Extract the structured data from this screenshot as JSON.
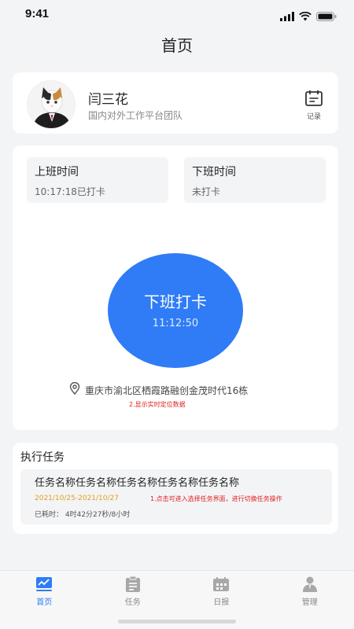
{
  "status_bar": {
    "time": "9:41",
    "icons": [
      "signal-icon",
      "wifi-icon",
      "battery-icon"
    ]
  },
  "nav": {
    "title": "首页"
  },
  "profile": {
    "name": "闫三花",
    "team": "国内对外工作平台团队",
    "record_label": "记录",
    "record_icon": "calendar-record-icon"
  },
  "attendance": {
    "clock_in": {
      "title": "上班时间",
      "value": "10:17:18已打卡"
    },
    "clock_out": {
      "title": "下班时间",
      "value": "未打卡"
    },
    "button": {
      "label": "下班打卡",
      "time": "11:12:50"
    },
    "location": {
      "text": "重庆市渝北区栖霞路融创金茂时代16栋",
      "note": "2.显示实时定位数据",
      "icon": "location-pin-icon"
    }
  },
  "tasks": {
    "section_title": "执行任务",
    "items": [
      {
        "name": "任务名称任务名称任务名称任务名称任务名称",
        "date_range": "2021/10/25-2021/10/27",
        "note": "1.点击可进入选择任务界面，进行切换任务操作",
        "elapsed": "已耗时：  4时42分27秒/8小时"
      }
    ]
  },
  "tab_bar": {
    "tabs": [
      {
        "label": "首页",
        "icon": "home-chart-icon",
        "active": true
      },
      {
        "label": "任务",
        "icon": "clipboard-icon",
        "active": false
      },
      {
        "label": "日报",
        "icon": "calendar-icon",
        "active": false
      },
      {
        "label": "管理",
        "icon": "manager-icon",
        "active": false
      }
    ]
  },
  "colors": {
    "accent": "#2f7cf6",
    "note_red": "#e02020",
    "date_orange": "#e0a020",
    "background": "#f3f4f6"
  }
}
